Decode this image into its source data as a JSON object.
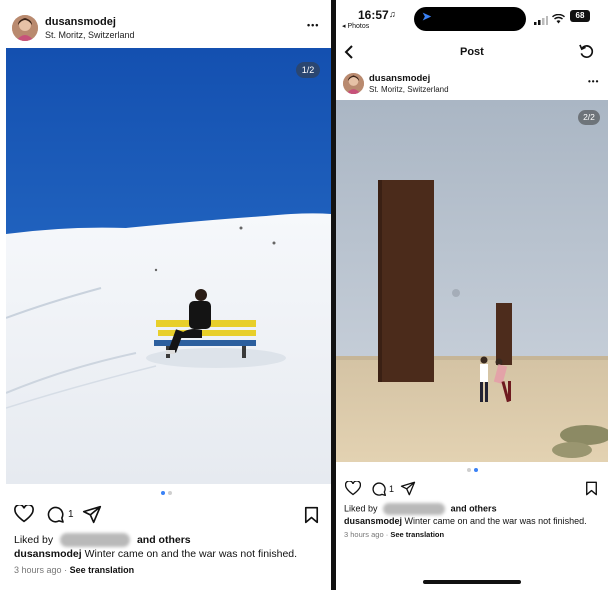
{
  "left_post": {
    "username": "dusansmodej",
    "location": "St. Moritz, Switzerland",
    "more_label": "•••",
    "photo_counter": "1/2",
    "carousel_total": 2,
    "carousel_active": 1,
    "comment_count": "1",
    "liked_prefix": "Liked by",
    "liked_suffix": "and others",
    "caption_user": "dusansmodej",
    "caption_text": "Winter came on and the war was not finished.",
    "timestamp": "3 hours ago",
    "meta_sep": "·",
    "see_translation": "See translation"
  },
  "right_post": {
    "status_time": "16:57",
    "status_back": "◂ Photos",
    "island_icon": "navigation-arrow-icon",
    "battery": "68",
    "nav_title": "Post",
    "username": "dusansmodej",
    "location": "St. Moritz, Switzerland",
    "more_label": "•••",
    "photo_counter": "2/2",
    "carousel_total": 2,
    "carousel_active": 2,
    "comment_count": "1",
    "liked_prefix": "Liked by",
    "liked_suffix": "and others",
    "caption_user": "dusansmodej",
    "caption_text": "Winter came on and the war was not finished.",
    "timestamp": "3 hours ago",
    "meta_sep": "·",
    "see_translation": "See translation"
  },
  "colors": {
    "sky_left": "#1c5fb8",
    "snow": "#f2f4f7",
    "bench_yellow": "#e8cf2a",
    "sky_right": "#b9c3cf",
    "sand": "#dcc9a6",
    "steel": "#4a2a1c",
    "accent_dot": "#3b82f6"
  }
}
